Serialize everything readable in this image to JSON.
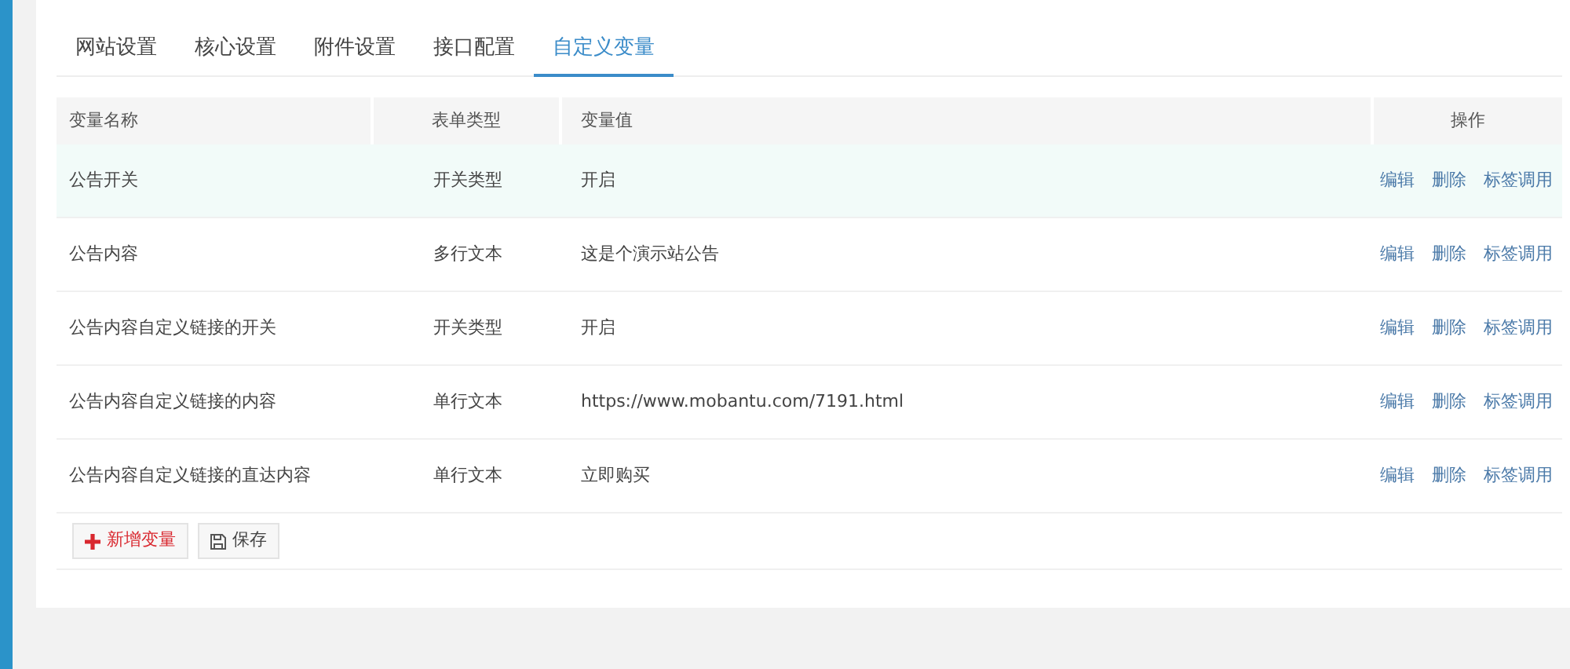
{
  "tabs": [
    {
      "label": "网站设置",
      "selected": false
    },
    {
      "label": "核心设置",
      "selected": false
    },
    {
      "label": "附件设置",
      "selected": false
    },
    {
      "label": "接口配置",
      "selected": false
    },
    {
      "label": "自定义变量",
      "selected": true
    }
  ],
  "table": {
    "columns": [
      "变量名称",
      "表单类型",
      "变量值",
      "操作"
    ],
    "rows": [
      {
        "name": "公告开关",
        "type": "开关类型",
        "value": "开启",
        "actions": [
          "编辑",
          "删除",
          "标签调用"
        ],
        "highlighted": true
      },
      {
        "name": "公告内容",
        "type": "多行文本",
        "value": "这是个演示站公告",
        "actions": [
          "编辑",
          "删除",
          "标签调用"
        ],
        "highlighted": false
      },
      {
        "name": "公告内容自定义链接的开关",
        "type": "开关类型",
        "value": "开启",
        "actions": [
          "编辑",
          "删除",
          "标签调用"
        ],
        "highlighted": false
      },
      {
        "name": "公告内容自定义链接的内容",
        "type": "单行文本",
        "value": "https://www.mobantu.com/7191.html",
        "actions": [
          "编辑",
          "删除",
          "标签调用"
        ],
        "highlighted": false
      },
      {
        "name": "公告内容自定义链接的直达内容",
        "type": "单行文本",
        "value": "立即购买",
        "actions": [
          "编辑",
          "删除",
          "标签调用"
        ],
        "highlighted": false
      }
    ]
  },
  "buttons": [
    {
      "kind": "add",
      "label": "新增变量"
    },
    {
      "kind": "save",
      "label": "保存"
    }
  ]
}
